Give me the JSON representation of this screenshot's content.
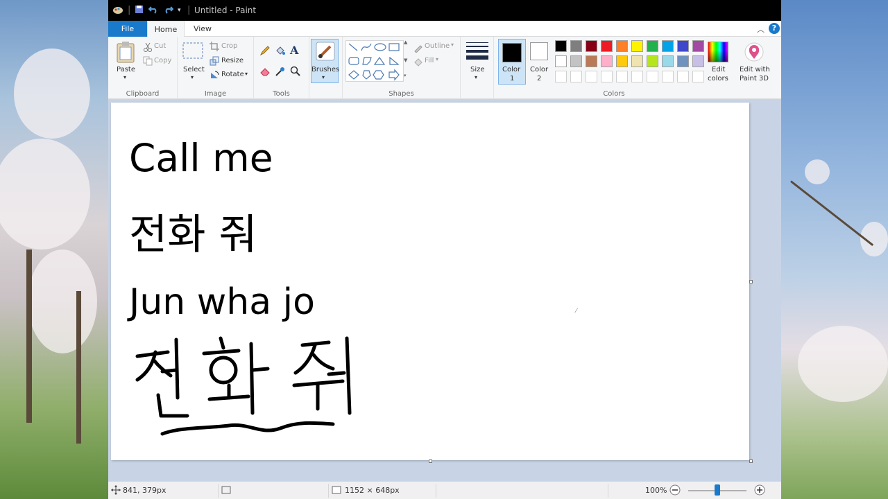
{
  "window": {
    "title": "Untitled - Paint"
  },
  "tabs": [
    {
      "label": "File"
    },
    {
      "label": "Home"
    },
    {
      "label": "View"
    }
  ],
  "ribbon": {
    "clipboard": {
      "paste": "Paste",
      "cut": "Cut",
      "copy": "Copy",
      "label": "Clipboard"
    },
    "image": {
      "select": "Select",
      "crop": "Crop",
      "resize": "Resize",
      "rotate": "Rotate",
      "label": "Image"
    },
    "tools": {
      "label": "Tools"
    },
    "brushes": {
      "label": "Brushes"
    },
    "shapes": {
      "outline": "Outline",
      "fill": "Fill",
      "label": "Shapes"
    },
    "size": {
      "label": "Size"
    },
    "colors": {
      "color1": "Color\n1",
      "color1_a": "Color",
      "color1_b": "1",
      "color2_a": "Color",
      "color2_b": "2",
      "edit_a": "Edit",
      "edit_b": "colors",
      "paint3d_a": "Edit with",
      "paint3d_b": "Paint 3D",
      "label": "Colors",
      "row1": [
        "#000000",
        "#7f7f7f",
        "#880015",
        "#ed1c24",
        "#ff7f27",
        "#fff200",
        "#22b14c",
        "#00a2e8",
        "#3f48cc",
        "#a349a4"
      ],
      "row2": [
        "#ffffff",
        "#c3c3c3",
        "#b97a57",
        "#ffaec9",
        "#ffc90e",
        "#efe4b0",
        "#b5e61d",
        "#99d9ea",
        "#7092be",
        "#c8bfe7"
      ]
    }
  },
  "canvas": {
    "line1": "Call me",
    "line2": "전화 줘",
    "line3": "Jun wha jo"
  },
  "status": {
    "cursor": "841, 379px",
    "dimensions": "1152 × 648px",
    "zoom": "100%",
    "zoom_fraction": 0.5
  }
}
